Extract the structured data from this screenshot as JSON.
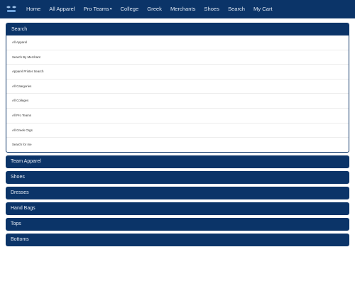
{
  "nav": {
    "items": [
      {
        "label": "Home"
      },
      {
        "label": "All Apparel"
      },
      {
        "label": "Pro Teams"
      },
      {
        "label": "College"
      },
      {
        "label": "Greek"
      },
      {
        "label": "Merchants"
      },
      {
        "label": "Shoes"
      },
      {
        "label": "Search"
      },
      {
        "label": "My Cart"
      }
    ],
    "pro_teams_caret": "▾"
  },
  "search_panel": {
    "title": "Search",
    "items": [
      {
        "label": "All Apparel"
      },
      {
        "label": "Search By Merchant"
      },
      {
        "label": "Apparel Printer Search"
      },
      {
        "label": "All Categories"
      },
      {
        "label": "All Colleges"
      },
      {
        "label": "All Pro Teams"
      },
      {
        "label": "All Greek Orgs"
      },
      {
        "label": "Search for me"
      }
    ]
  },
  "category_bars": [
    {
      "label": "Team Apparel"
    },
    {
      "label": "Shoes"
    },
    {
      "label": "Dresses"
    },
    {
      "label": "Hand Bags"
    },
    {
      "label": "Tops"
    },
    {
      "label": "Bottoms"
    }
  ],
  "colors": {
    "nav_bg": "#0b3468",
    "panel_bg": "#0b3468",
    "nav_text": "#dfe8f4"
  }
}
